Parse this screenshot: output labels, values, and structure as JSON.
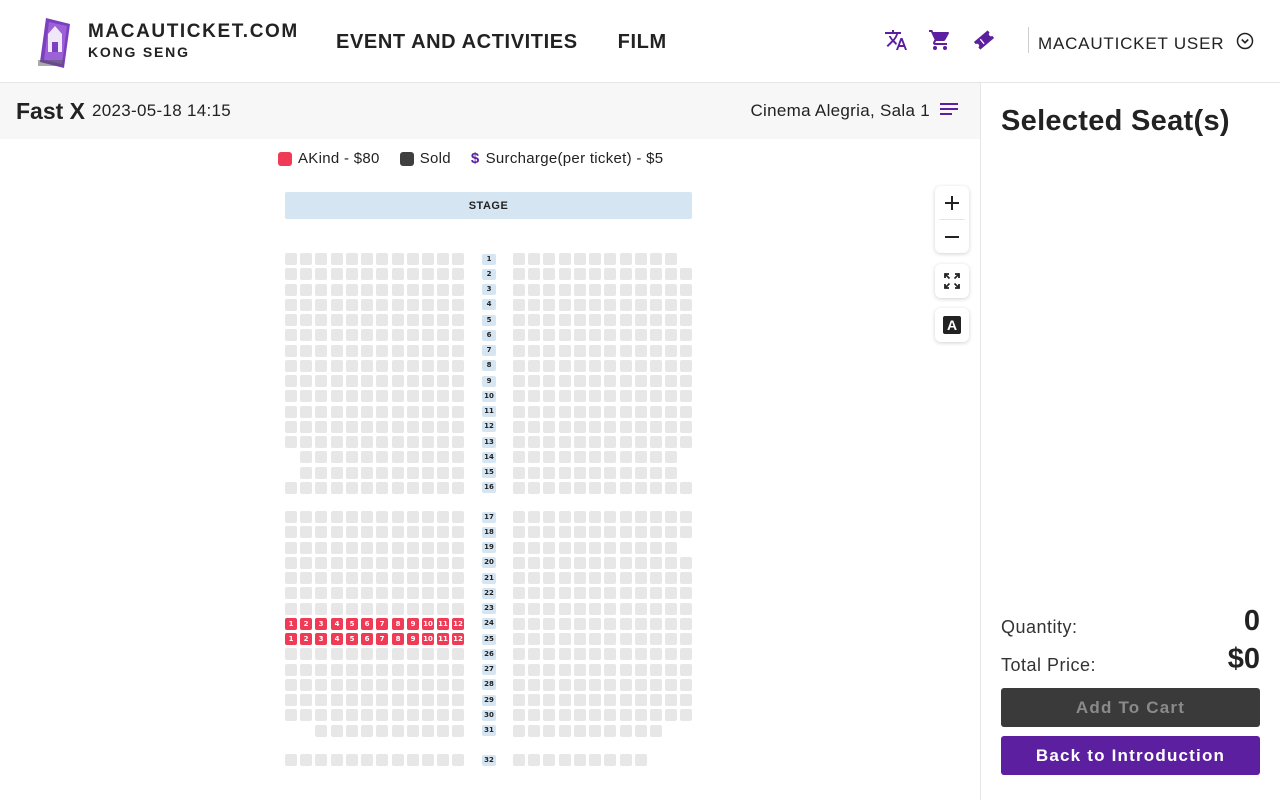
{
  "header": {
    "logo_title": "MACAUTICKET.COM",
    "logo_subtitle": "KONG SENG",
    "nav": [
      {
        "label": "EVENT AND ACTIVITIES"
      },
      {
        "label": "FILM"
      }
    ],
    "icons": [
      "translate-icon",
      "cart-icon",
      "ticket-icon"
    ],
    "user_name": "MACAUTICKET USER"
  },
  "event": {
    "title": "Fast X",
    "datetime": "2023-05-18 14:15",
    "venue": "Cinema Alegria, Sala 1"
  },
  "legend": {
    "akind": "AKind - $80",
    "sold": "Sold",
    "surcharge_symbol": "$",
    "surcharge": "Surcharge(per ticket) - $5"
  },
  "stage_label": "STAGE",
  "colors": {
    "accent": "#5b1fa0",
    "available": "#ef3b56",
    "sold": "#3f3f3f",
    "unavailable": "#e7e7e7",
    "row_label_bg": "#d5e6f2"
  },
  "seatmap": {
    "rows": [
      "1",
      "2",
      "3",
      "4",
      "5",
      "6",
      "7",
      "8",
      "9",
      "10",
      "11",
      "12",
      "13",
      "14",
      "15",
      "16",
      "17",
      "18",
      "19",
      "20",
      "21",
      "22",
      "23",
      "24",
      "25",
      "26",
      "27",
      "28",
      "29",
      "30",
      "31",
      "32"
    ],
    "available_rows": [
      "24",
      "25"
    ],
    "available_seat_numbers": [
      "1",
      "2",
      "3",
      "4",
      "5",
      "6",
      "7",
      "8",
      "9",
      "10",
      "11",
      "12"
    ]
  },
  "controls": {
    "zoom_in": "zoom-in",
    "zoom_out": "zoom-out",
    "fullscreen": "fullscreen",
    "font": "A"
  },
  "panel": {
    "title": "Selected Seat(s)",
    "quantity_label": "Quantity:",
    "quantity_value": "0",
    "total_label": "Total Price:",
    "total_value": "$0",
    "add_to_cart": "Add To Cart",
    "back": "Back to Introduction"
  }
}
